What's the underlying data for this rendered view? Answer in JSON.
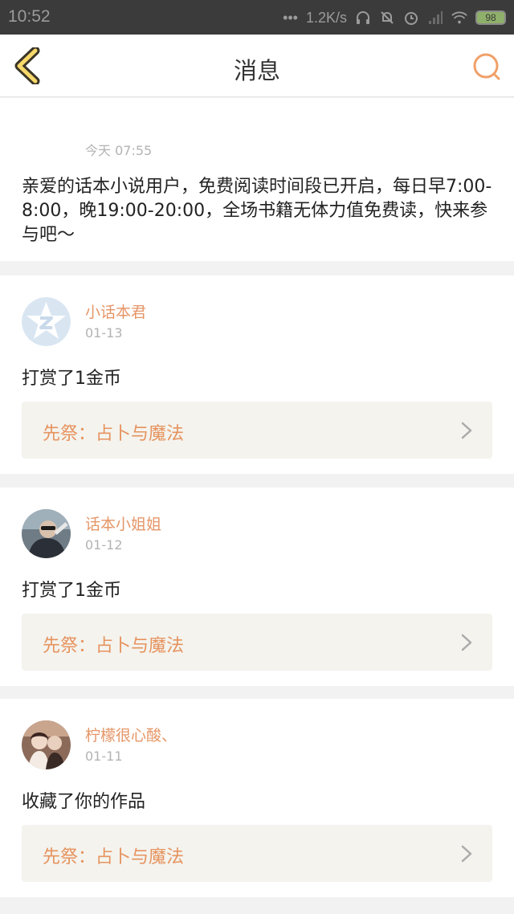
{
  "status_bar": {
    "time": "10:52",
    "more": "•••",
    "net_speed": "1.2K/s",
    "battery": "98"
  },
  "header": {
    "title": "消息",
    "back_icon": "back-chevron-icon",
    "search_icon": "search-icon"
  },
  "system_message": {
    "time": "今天 07:55",
    "text": "亲爱的话本小说用户，免费阅读时间段已开启，每日早7:00-8:00，晚19:00-20:00，全场书籍无体力值免费读，快来参与吧～"
  },
  "messages": [
    {
      "user": "小话本君",
      "date": "01-13",
      "action": "打赏了1金币",
      "book": "先祭：占卜与魔法"
    },
    {
      "user": "话本小姐姐",
      "date": "01-12",
      "action": "打赏了1金币",
      "book": "先祭：占卜与魔法"
    },
    {
      "user": "柠檬很心酸、",
      "date": "01-11",
      "action": "收藏了你的作品",
      "book": "先祭：占卜与魔法"
    }
  ],
  "colors": {
    "accent": "#e59667",
    "back_arrow_fill": "#f7d86a",
    "back_arrow_stroke": "#3b3527",
    "status_bar_bg": "#3b3b3b"
  }
}
